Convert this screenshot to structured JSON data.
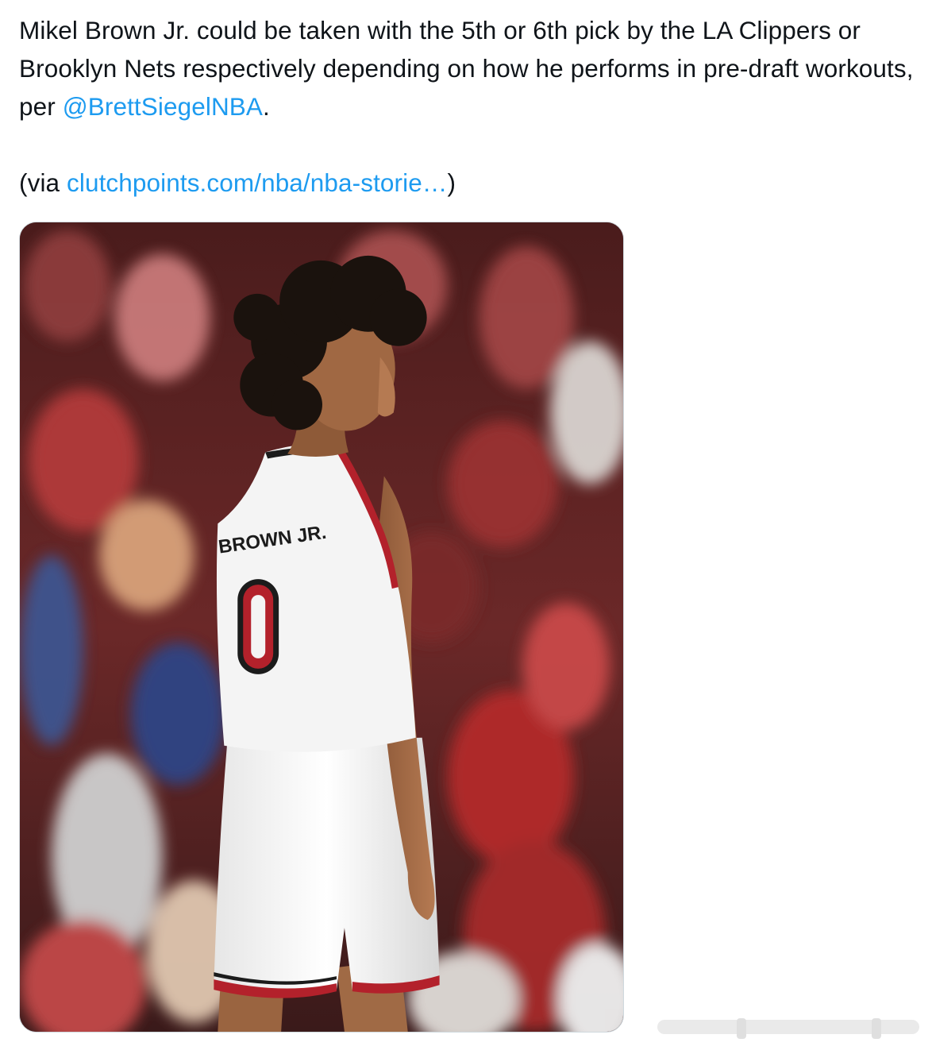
{
  "tweet": {
    "line1_prefix": "Mikel Brown Jr. could be taken with the 5th or 6th pick by the LA Clippers or Brooklyn Nets respectively depending on how he performs in pre-draft workouts, per ",
    "mention": "@BrettSiegelNBA",
    "line1_suffix": ".",
    "via_prefix": "(via ",
    "via_link": "clutchpoints.com/nba/nba-storie…",
    "via_suffix": ")"
  },
  "media": {
    "jersey_name": "BROWN JR.",
    "jersey_number": "0"
  },
  "colors": {
    "link": "#1d9bf0",
    "text": "#0f1419",
    "jersey_red": "#b3212b"
  }
}
